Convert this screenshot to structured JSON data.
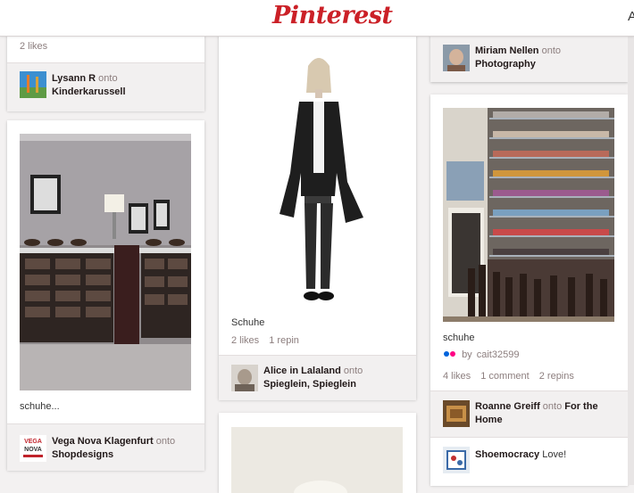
{
  "header": {
    "logo": "Pinterest",
    "right_text": "A"
  },
  "col1": {
    "pin_a": {
      "likes": "2 likes",
      "user": "Lysann R",
      "onto": "onto",
      "board": "Kinderkarussell"
    },
    "pin_b": {
      "description": "schuhe...",
      "user": "Vega Nova Klagenfurt",
      "onto": "onto",
      "board": "Shopdesigns",
      "avatar_text": [
        "VEGA",
        "NOVA"
      ]
    }
  },
  "col2": {
    "pin_a": {
      "description": "Schuhe",
      "likes": "2 likes",
      "repins": "1 repin",
      "user": "Alice in Lalaland",
      "onto": "onto",
      "board": "Spieglein, Spieglein"
    }
  },
  "col3": {
    "pin_a": {
      "user": "Miriam Nellen",
      "onto": "onto",
      "board": "Photography"
    },
    "pin_b": {
      "description": "schuhe",
      "by": "by",
      "source_user": "cait32599",
      "likes": "4 likes",
      "comments": "1 comment",
      "repins": "2 repins",
      "user": "Roanne Greiff",
      "onto": "onto",
      "board_line1": "For the",
      "board_line2": "Home",
      "commenter": "Shoemocracy",
      "comment": "Love!"
    }
  },
  "colors": {
    "brand": "#cb2027",
    "background": "#f3f1f1",
    "muted": "#8c7e7e"
  }
}
